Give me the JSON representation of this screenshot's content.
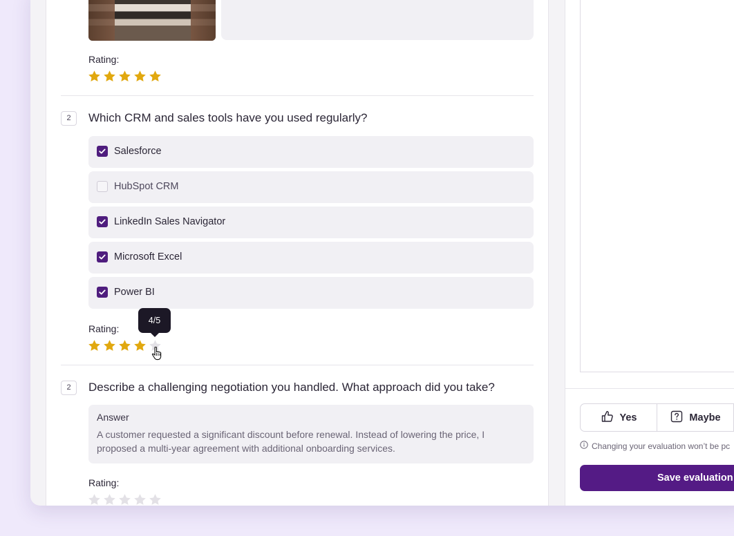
{
  "colors": {
    "accent": "#541b85",
    "star_on": "#e1a80f",
    "star_off": "#e3e1e6"
  },
  "q1": {
    "rating_label": "Rating:",
    "rating": 5,
    "max": 5
  },
  "q2": {
    "number": "2",
    "question": "Which CRM and sales tools have you used regularly?",
    "options": [
      {
        "label": "Salesforce",
        "checked": true
      },
      {
        "label": "HubSpot CRM",
        "checked": false
      },
      {
        "label": "LinkedIn Sales Navigator",
        "checked": true
      },
      {
        "label": "Microsoft Excel",
        "checked": true
      },
      {
        "label": "Power BI",
        "checked": true
      }
    ],
    "rating_label": "Rating:",
    "rating": 4,
    "max": 5,
    "tooltip": "4/5"
  },
  "q3": {
    "number": "2",
    "question": "Describe a challenging negotiation you handled. What approach did you take?",
    "answer_title": "Answer",
    "answer": "A customer requested a significant discount before renewal. Instead of lowering the price, I proposed a multi-year agreement with additional onboarding services.",
    "rating_label": "Rating:",
    "rating": 0,
    "max": 5
  },
  "sidebar": {
    "vote_yes": "Yes",
    "vote_maybe": "Maybe",
    "yes_icon": "thumbs-up-icon",
    "maybe_icon": "question-square-icon",
    "hint": "Changing your evaluation won’t be pc",
    "hint_icon": "info-icon",
    "save": "Save evaluation"
  }
}
